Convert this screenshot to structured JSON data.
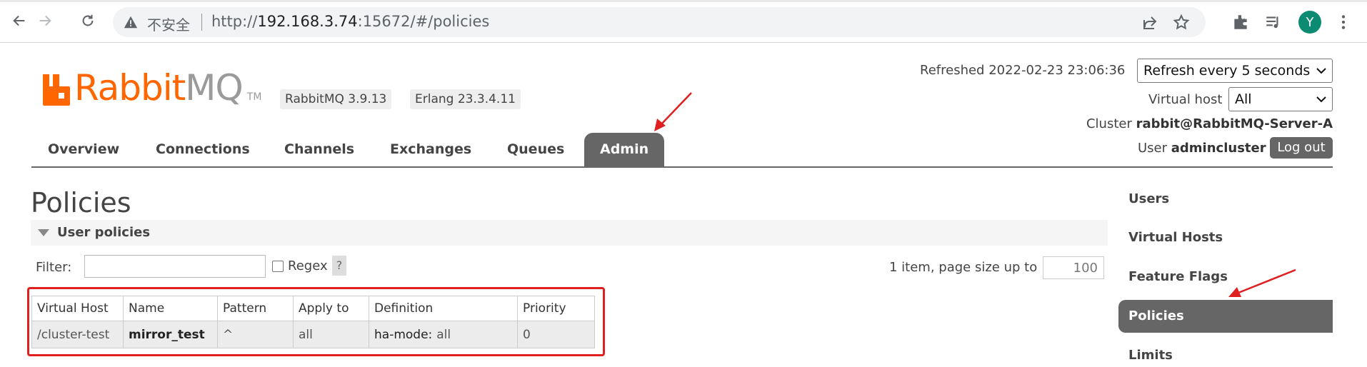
{
  "browser": {
    "insecure_label": "不安全",
    "url_prefix": "http://",
    "url_host": "192.168.3.74",
    "url_rest": ":15672/#/policies",
    "avatar_letter": "Y"
  },
  "header": {
    "logo_rabbit": "Rabbit",
    "logo_mq": "MQ",
    "logo_tm": "TM",
    "rabbitmq_version": "RabbitMQ 3.9.13",
    "erlang_version": "Erlang 23.3.4.11",
    "refreshed_label": "Refreshed 2022-02-23 23:06:36",
    "refresh_select": "Refresh every 5 seconds",
    "vhost_label": "Virtual host",
    "vhost_select": "All",
    "cluster_label": "Cluster",
    "cluster_value": "rabbit@RabbitMQ-Server-A",
    "user_label": "User",
    "user_value": "admincluster",
    "logout_label": "Log out"
  },
  "tabs": [
    {
      "label": "Overview"
    },
    {
      "label": "Connections"
    },
    {
      "label": "Channels"
    },
    {
      "label": "Exchanges"
    },
    {
      "label": "Queues"
    },
    {
      "label": "Admin",
      "active": true
    }
  ],
  "page": {
    "title": "Policies",
    "section_label": "User policies",
    "filter_label": "Filter:",
    "filter_value": "",
    "regex_label": "Regex",
    "help_label": "?",
    "page_info": "1 item, page size up to",
    "page_size": "100"
  },
  "table": {
    "headers": [
      "Virtual Host",
      "Name",
      "Pattern",
      "Apply to",
      "Definition",
      "Priority"
    ],
    "rows": [
      {
        "vhost": "/cluster-test",
        "name": "mirror_test",
        "pattern": "^",
        "apply_to": "all",
        "definition_key": "ha-mode:",
        "definition_value": "all",
        "priority": "0"
      }
    ]
  },
  "sidebar": {
    "items": [
      {
        "label": "Users"
      },
      {
        "label": "Virtual Hosts"
      },
      {
        "label": "Feature Flags"
      },
      {
        "label": "Policies",
        "active": true
      },
      {
        "label": "Limits"
      }
    ]
  },
  "colors": {
    "brand_orange": "#ff6600",
    "active_tab": "#666666",
    "annotation_red": "#e02020"
  }
}
